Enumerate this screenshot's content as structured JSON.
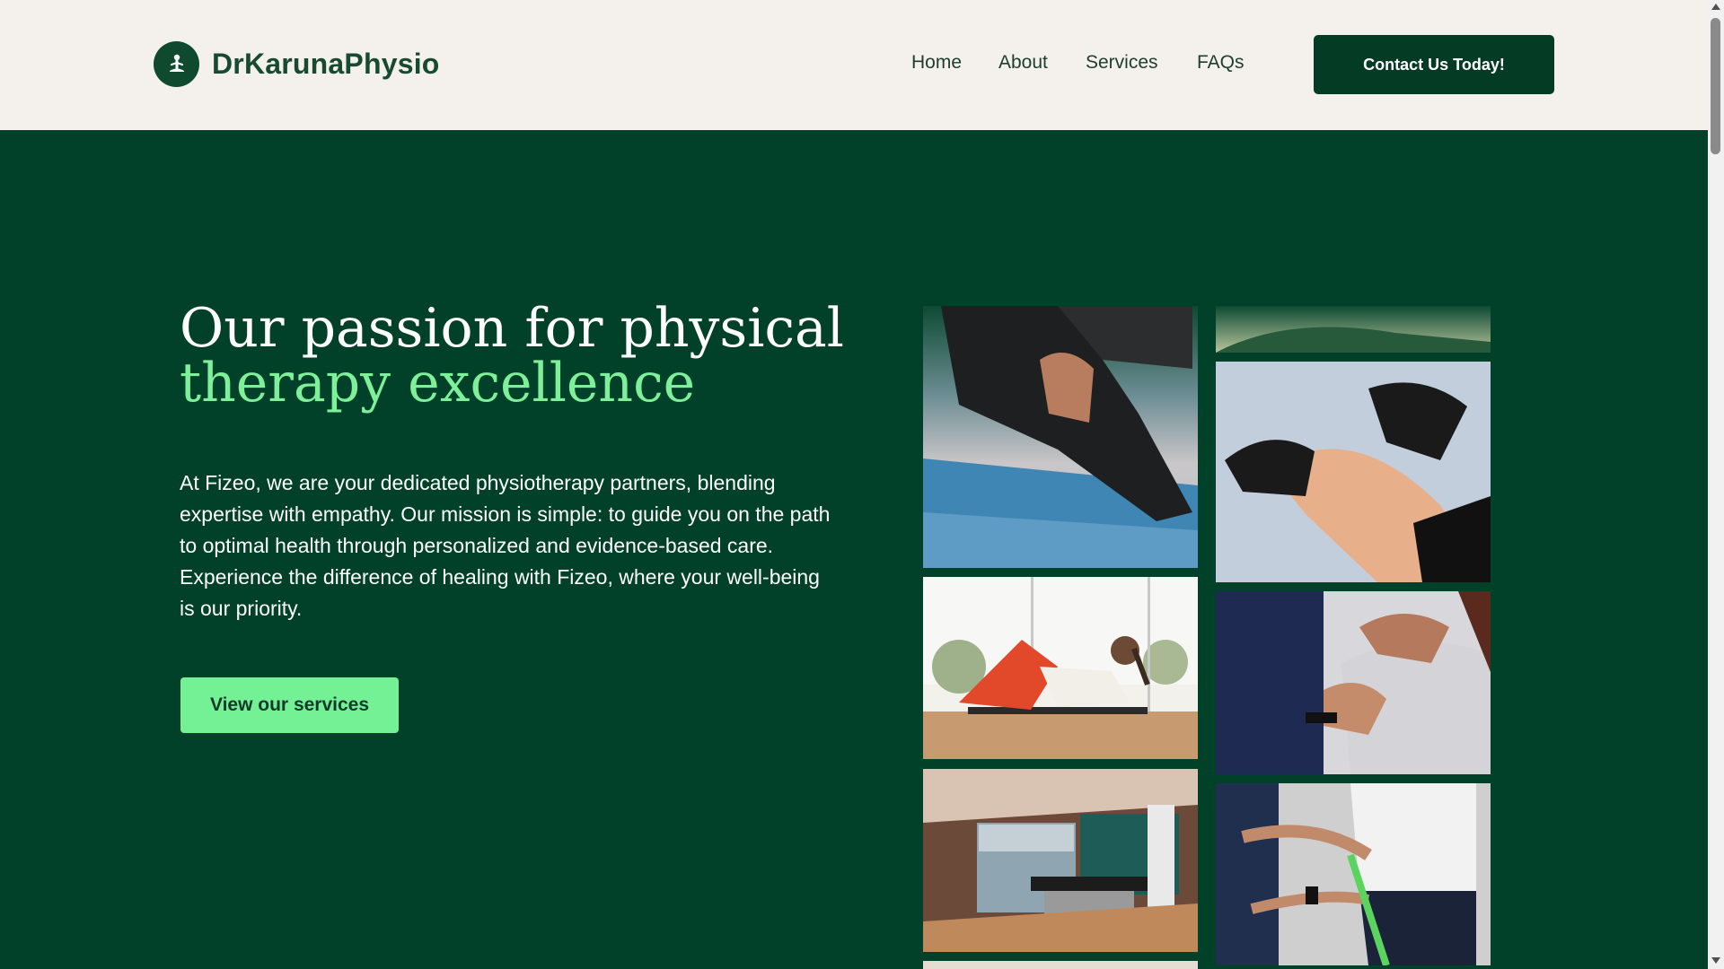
{
  "brand": {
    "name": "DrKarunaPhysio",
    "icon": "meditation-person-icon"
  },
  "nav": {
    "items": [
      {
        "label": "Home"
      },
      {
        "label": "About"
      },
      {
        "label": "Services"
      },
      {
        "label": "FAQs"
      }
    ],
    "cta_label": "Contact Us Today!"
  },
  "hero": {
    "title_line1": "Our passion for physical",
    "title_line2": "therapy excellence",
    "description": "At Fizeo, we are your dedicated physiotherapy partners, blending expertise with empathy. Our mission is simple: to guide you on the path to optimal health through personalized and evidence-based care. Experience the difference of healing with Fizeo, where your well-being is our priority.",
    "button_label": "View our services"
  },
  "colors": {
    "header_bg": "#f4f1ec",
    "page_bg": "#01412a",
    "accent_green": "#74f195",
    "title_green": "#7df099",
    "cta_bg": "#033b24"
  }
}
